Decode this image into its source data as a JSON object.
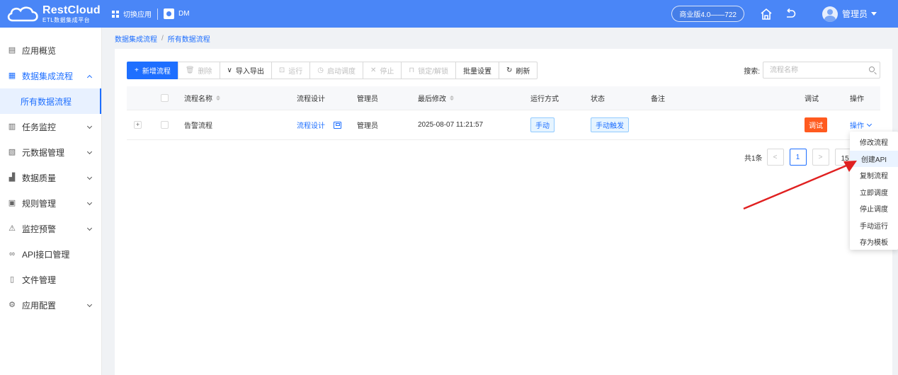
{
  "header": {
    "logo_title": "RestCloud",
    "logo_subtitle": "ETL数据集成平台",
    "switch_app_label": "切换应用",
    "app_name": "DM",
    "version": "商业版4.0——722",
    "user_name": "管理员"
  },
  "sidebar": {
    "items": [
      {
        "label": "应用概览",
        "icon": "overview-icon"
      },
      {
        "label": "数据集成流程",
        "icon": "integration-icon"
      },
      {
        "label": "所有数据流程"
      },
      {
        "label": "任务监控",
        "icon": "monitor-icon"
      },
      {
        "label": "元数据管理",
        "icon": "metadata-icon"
      },
      {
        "label": "数据质量",
        "icon": "quality-chart-icon"
      },
      {
        "label": "规则管理",
        "icon": "rules-icon"
      },
      {
        "label": "监控预警",
        "icon": "alarm-icon"
      },
      {
        "label": "API接口管理",
        "icon": "api-link-icon"
      },
      {
        "label": "文件管理",
        "icon": "file-icon"
      },
      {
        "label": "应用配置",
        "icon": "settings-gear-icon"
      }
    ]
  },
  "breadcrumb": {
    "items": [
      "数据集成流程",
      "所有数据流程"
    ],
    "separator": "/"
  },
  "toolbar": {
    "add": "新增流程",
    "delete": "删除",
    "import_export": "导入导出",
    "run": "运行",
    "start_schedule": "启动调度",
    "stop": "停止",
    "lock_unlock": "锁定/解锁",
    "batch_settings": "批量设置",
    "refresh": "刷新"
  },
  "search": {
    "label": "搜索:",
    "placeholder": "流程名称"
  },
  "table": {
    "columns": {
      "name": "流程名称",
      "design": "流程设计",
      "admin": "管理员",
      "modified": "最后修改",
      "run_mode": "运行方式",
      "status": "状态",
      "remark": "备注",
      "debug": "调试",
      "action": "操作"
    },
    "rows": [
      {
        "name": "告警流程",
        "design": "流程设计",
        "admin": "管理员",
        "modified": "2025-08-07 11:21:57",
        "run_mode": "手动",
        "status": "手动触发",
        "remark": "",
        "debug": "调试",
        "action": "操作"
      }
    ]
  },
  "pagination": {
    "total": "共1条",
    "prev": "<",
    "current": "1",
    "next": ">",
    "page_size": "15 条/页"
  },
  "dropdown": {
    "items": [
      "修改流程",
      "创建API",
      "复制流程",
      "立即调度",
      "停止调度",
      "手动运行",
      "存为模板"
    ]
  },
  "colors": {
    "header": "#4a86f7",
    "primary": "#1e6fff",
    "debug_tag": "#ff5a1f",
    "annotation_arrow": "#e02020"
  }
}
